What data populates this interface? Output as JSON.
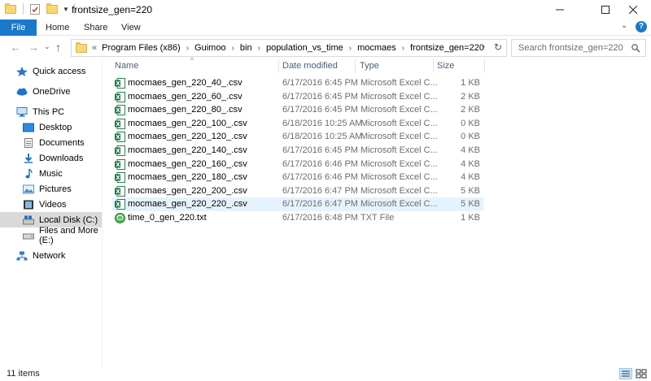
{
  "window": {
    "title": "frontsize_gen=220",
    "minimize_icon": "minimize-icon",
    "maximize_icon": "maximize-icon",
    "close_icon": "close-icon"
  },
  "ribbon": {
    "tabs": [
      "File",
      "Home",
      "Share",
      "View"
    ],
    "file_tab_color": "#1979ca"
  },
  "address": {
    "crumbs": [
      "Program Files (x86)",
      "Guimoo",
      "bin",
      "population_vs_time",
      "mocmaes",
      "frontsize_gen=220"
    ],
    "search_placeholder": "Search frontsize_gen=220"
  },
  "nav": {
    "items": [
      {
        "label": "Quick access",
        "icon": "star-icon"
      },
      {
        "label": "OneDrive",
        "icon": "cloud-icon"
      },
      {
        "label": "This PC",
        "icon": "computer-icon"
      },
      {
        "label": "Desktop",
        "icon": "desktop-icon"
      },
      {
        "label": "Documents",
        "icon": "documents-icon"
      },
      {
        "label": "Downloads",
        "icon": "download-icon"
      },
      {
        "label": "Music",
        "icon": "music-icon"
      },
      {
        "label": "Pictures",
        "icon": "pictures-icon"
      },
      {
        "label": "Videos",
        "icon": "videos-icon"
      },
      {
        "label": "Local Disk (C:)",
        "icon": "disk-icon"
      },
      {
        "label": "Files and More (E:)",
        "icon": "drive-icon"
      },
      {
        "label": "Network",
        "icon": "network-icon"
      }
    ],
    "selected": "Local Disk (C:)"
  },
  "columns": {
    "name": "Name",
    "date": "Date modified",
    "type": "Type",
    "size": "Size"
  },
  "files": [
    {
      "name": "mocmaes_gen_220_40_.csv",
      "date": "6/17/2016 6:45 PM",
      "type": "Microsoft Excel C...",
      "size": "1 KB",
      "icon": "excel-icon"
    },
    {
      "name": "mocmaes_gen_220_60_.csv",
      "date": "6/17/2016 6:45 PM",
      "type": "Microsoft Excel C...",
      "size": "2 KB",
      "icon": "excel-icon"
    },
    {
      "name": "mocmaes_gen_220_80_.csv",
      "date": "6/17/2016 6:45 PM",
      "type": "Microsoft Excel C...",
      "size": "2 KB",
      "icon": "excel-icon"
    },
    {
      "name": "mocmaes_gen_220_100_.csv",
      "date": "6/18/2016 10:25 AM",
      "type": "Microsoft Excel C...",
      "size": "0 KB",
      "icon": "excel-icon"
    },
    {
      "name": "mocmaes_gen_220_120_.csv",
      "date": "6/18/2016 10:25 AM",
      "type": "Microsoft Excel C...",
      "size": "0 KB",
      "icon": "excel-icon"
    },
    {
      "name": "mocmaes_gen_220_140_.csv",
      "date": "6/17/2016 6:45 PM",
      "type": "Microsoft Excel C...",
      "size": "4 KB",
      "icon": "excel-icon"
    },
    {
      "name": "mocmaes_gen_220_160_.csv",
      "date": "6/17/2016 6:46 PM",
      "type": "Microsoft Excel C...",
      "size": "4 KB",
      "icon": "excel-icon"
    },
    {
      "name": "mocmaes_gen_220_180_.csv",
      "date": "6/17/2016 6:46 PM",
      "type": "Microsoft Excel C...",
      "size": "4 KB",
      "icon": "excel-icon"
    },
    {
      "name": "mocmaes_gen_220_200_.csv",
      "date": "6/17/2016 6:47 PM",
      "type": "Microsoft Excel C...",
      "size": "5 KB",
      "icon": "excel-icon"
    },
    {
      "name": "mocmaes_gen_220_220_.csv",
      "date": "6/17/2016 6:47 PM",
      "type": "Microsoft Excel C...",
      "size": "5 KB",
      "icon": "excel-icon"
    },
    {
      "name": "time_0_gen_220.txt",
      "date": "6/17/2016 6:48 PM",
      "type": "TXT File",
      "size": "1 KB",
      "icon": "text-file-icon"
    }
  ],
  "selected_file": "mocmaes_gen_220_220_.csv",
  "status": {
    "item_count": "11 items"
  }
}
